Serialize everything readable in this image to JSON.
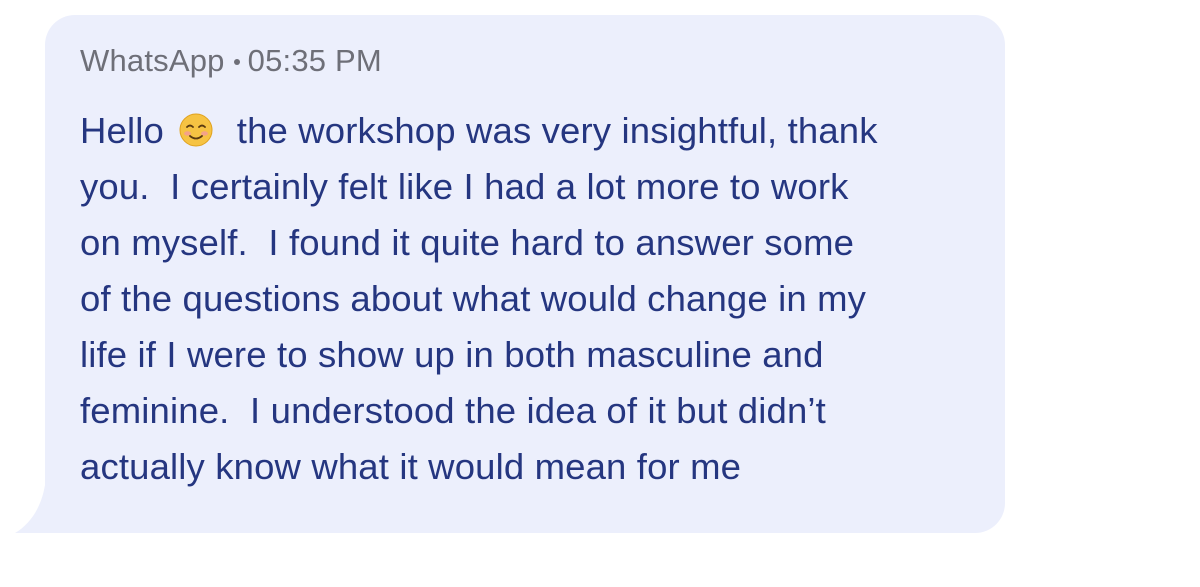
{
  "message": {
    "app_name": "WhatsApp",
    "time": "05:35 PM",
    "text_before_emoji": "Hello ",
    "emoji": "smiling-face-icon",
    "lines": [
      "  the workshop was very insightful, thank",
      "you.  I certainly felt like I had a lot more to work",
      "on myself.  I found it quite hard to answer some",
      "of the questions about what would change in my",
      "life if I were to show up in both masculine and",
      "feminine.  I understood the idea of it but didn’t",
      "actually know what it would mean for me"
    ]
  },
  "colors": {
    "bubble_background": "#eceffc",
    "meta_text": "#6e6f78",
    "message_text": "#253680"
  }
}
